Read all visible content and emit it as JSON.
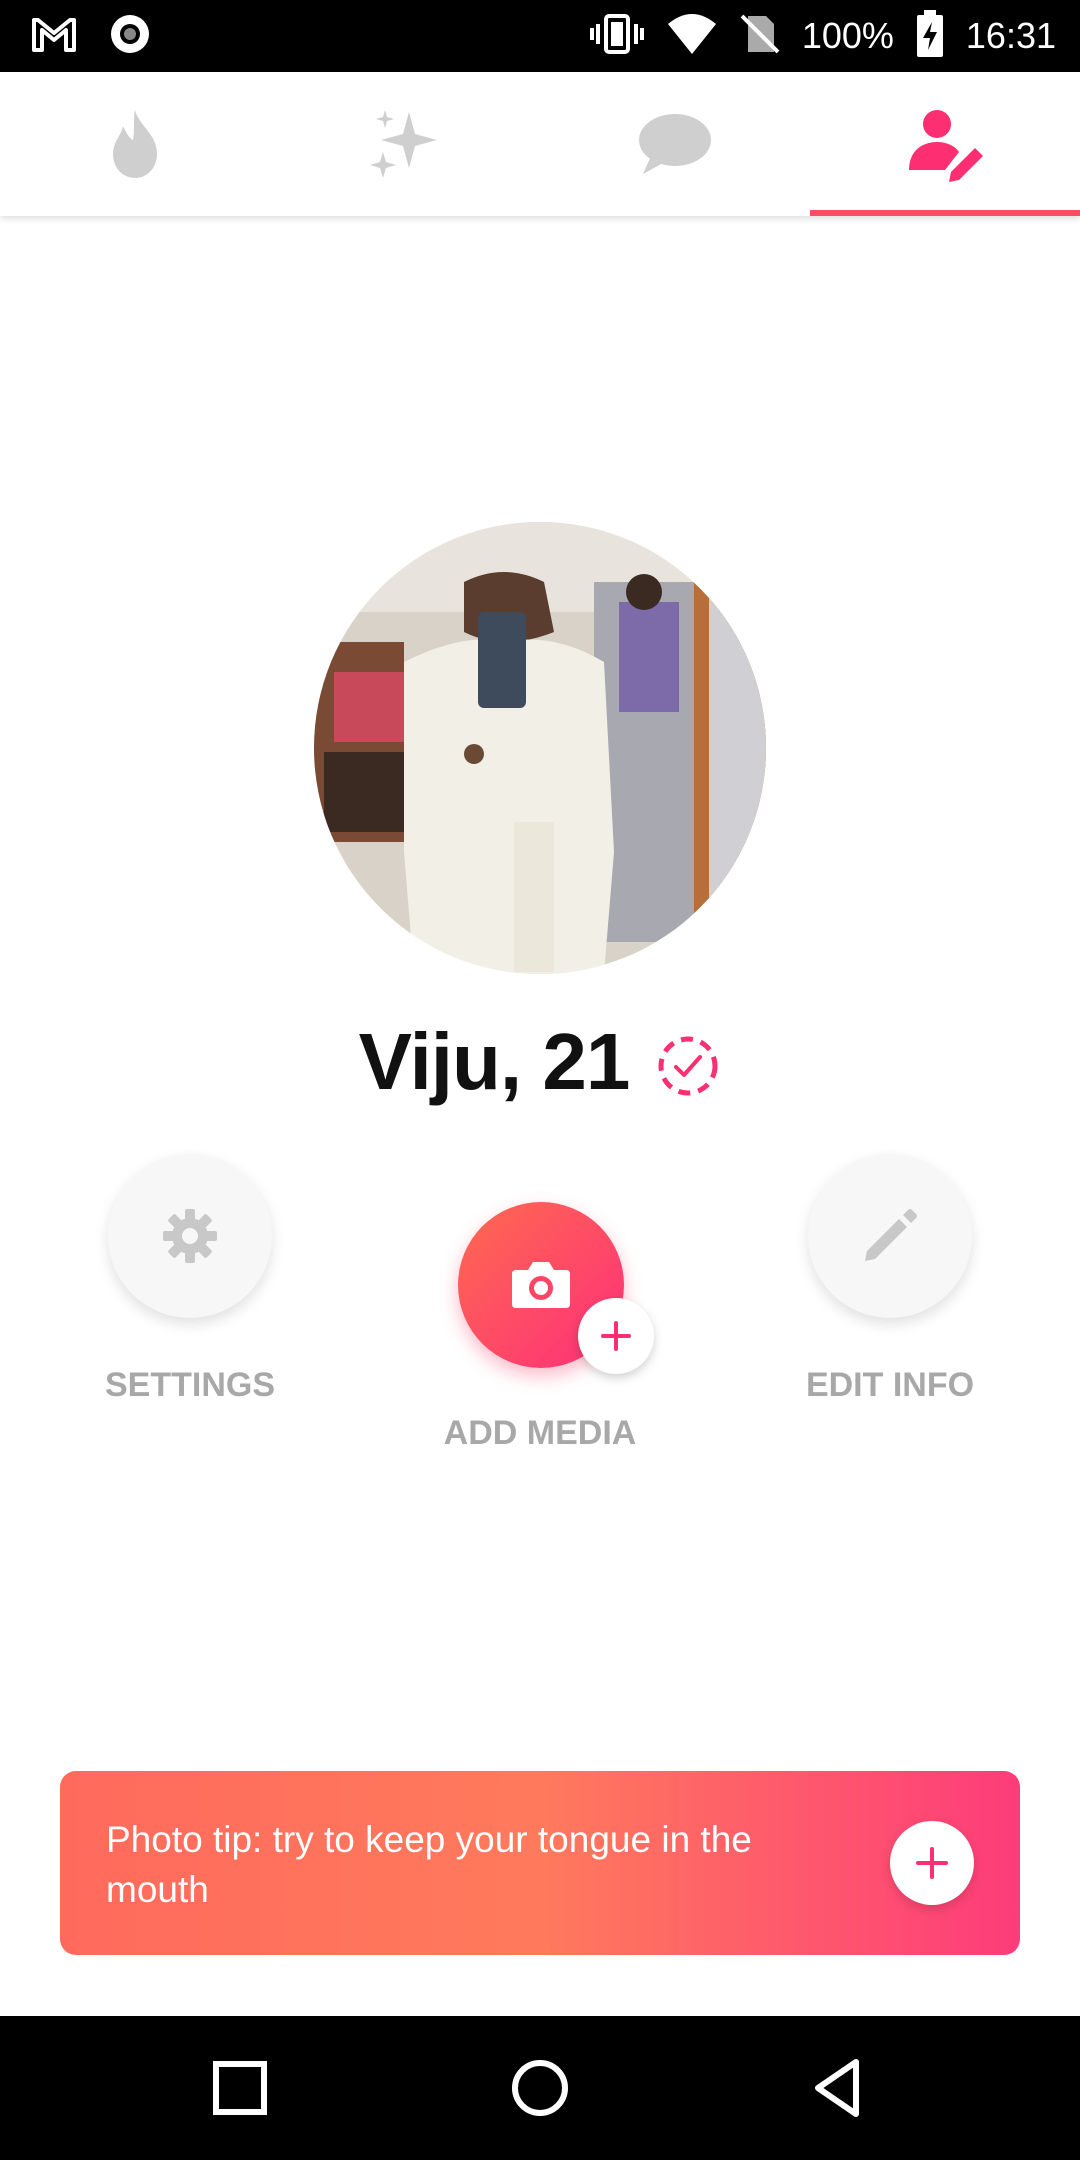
{
  "status_bar": {
    "battery": "100%",
    "time": "16:31",
    "icons": [
      "gmail-icon",
      "record-icon",
      "vibrate-icon",
      "wifi-icon",
      "no-sim-icon",
      "battery-charging-icon"
    ]
  },
  "tabs": [
    {
      "name": "discover",
      "icon": "flame-icon",
      "active": false
    },
    {
      "name": "top-picks",
      "icon": "sparkle-icon",
      "active": false
    },
    {
      "name": "messages",
      "icon": "chat-icon",
      "active": false
    },
    {
      "name": "profile",
      "icon": "profile-edit-icon",
      "active": true
    }
  ],
  "profile": {
    "name_age": "Viju, 21",
    "verify_icon": "verify-badge-icon"
  },
  "actions": {
    "settings_label": "SETTINGS",
    "add_media_label": "ADD MEDIA",
    "edit_info_label": "EDIT INFO"
  },
  "tip": {
    "text": "Photo tip: try to keep your tongue in the mouth"
  },
  "colors": {
    "accent": "#fd4d63",
    "gradient_start": "#ff6a5c",
    "gradient_end": "#fd3c7a",
    "label_gray": "#a8a8a8",
    "icon_gray": "#c8c8c8"
  },
  "nav": [
    "recents-icon",
    "home-icon",
    "back-icon"
  ]
}
